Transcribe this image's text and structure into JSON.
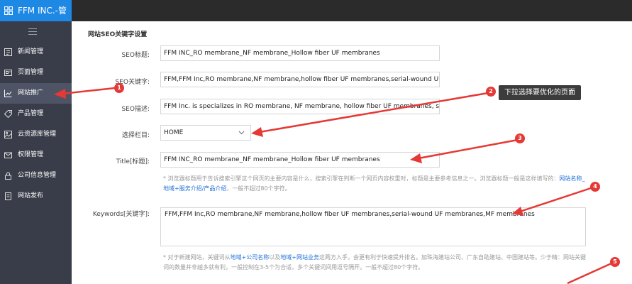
{
  "app": {
    "title": "FFM INC.-管",
    "logo_icon": "grid-icon",
    "brand_color": "#1e88e5"
  },
  "sidebar": {
    "collapse_icon": "menu-icon",
    "items": [
      {
        "label": "新闻管理",
        "icon": "news-icon"
      },
      {
        "label": "页面管理",
        "icon": "page-icon"
      },
      {
        "label": "网站推广",
        "icon": "chart-icon",
        "active": true
      },
      {
        "label": "产品管理",
        "icon": "tag-icon"
      },
      {
        "label": "云资源库管理",
        "icon": "image-icon"
      },
      {
        "label": "权限管理",
        "icon": "mail-icon"
      },
      {
        "label": "公司信息管理",
        "icon": "lock-icon"
      },
      {
        "label": "网站发布",
        "icon": "document-icon"
      }
    ]
  },
  "main": {
    "section_title": "网站SEO关键字设置",
    "seo_title": {
      "label": "SEO标题:",
      "value": "FFM INC_RO membrane_NF membrane_Hollow fiber UF membranes"
    },
    "seo_keywords": {
      "label": "SEO关键字:",
      "value": "FFM,FFM Inc,RO membrane,NF membrane,hollow fiber UF membranes,serial-wound UF meml"
    },
    "seo_desc": {
      "label": "SEO描述:",
      "value": "FFM Inc. is specializes in RO membrane, NF membrane, hollow fiber UF membranes, serial-wc"
    },
    "column": {
      "label": "选择栏目:",
      "value": "HOME"
    },
    "title": {
      "label": "Title[标题]:",
      "value": "FFM INC_RO membrane_NF membrane_Hollow fiber UF membranes"
    },
    "title_note": {
      "part1": "* 浏览器标题用于告诉搜索引擎这个网页的主要内容是什么，搜索引擎在判断一个网页内容权重时，标题是主要参考信息之一。浏览器标题一般是这样填写的：",
      "link": "网站名称_地域+服务介绍/产品介绍",
      "part2": "，一般不超过80个字符。"
    },
    "keywords": {
      "label": "Keywords[关键字]:",
      "value": "FFM,FFM Inc,RO membrane,NF membrane,hollow fiber UF membranes,serial-wound UF membranes,MF membranes"
    },
    "keywords_note": {
      "part1": "* 对于新建网站，关键词从",
      "link1": "地域+公司名称",
      "part2": "以及",
      "link2": "地域+网站业务",
      "part3": "这两方入手，会更有利于快速提升排名。加珠海建站公司、广东自助建站、中国建站等。少于精：网站关键词的数量并非越多就有利，一般控制在3-5个为合适，多个关键词间用逗号隔开。一般不超过80个字符。"
    }
  },
  "annotations": {
    "color": "#e53935",
    "markers": [
      "1",
      "2",
      "3",
      "4",
      "5"
    ],
    "tooltip": "下拉选择要优化的页面"
  }
}
